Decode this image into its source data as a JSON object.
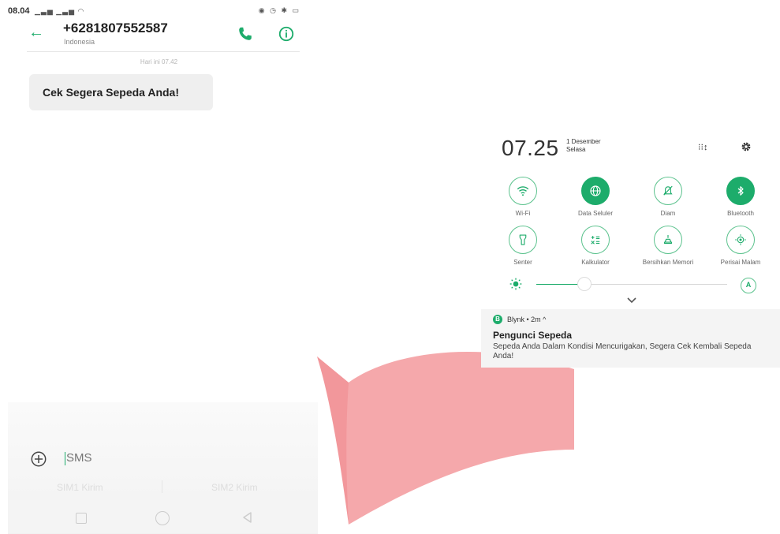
{
  "sms_screen": {
    "status_time": "08.04",
    "contact_number": "+6281807552587",
    "contact_country": "Indonesia",
    "message_date": "Hari ini 07.42",
    "message_text": "Cek Segera Sepeda Anda!",
    "compose_placeholder": "SMS",
    "sim1_label": "SIM1 Kirim",
    "sim2_label": "SIM2 Kirim"
  },
  "quick_settings": {
    "time": "07.25",
    "date_line1": "1 Desember",
    "date_line2": "Selasa",
    "tiles": [
      {
        "label": "Wi-Fi",
        "icon": "wifi-icon",
        "active": false
      },
      {
        "label": "Data Seluler",
        "icon": "globe-icon",
        "active": true
      },
      {
        "label": "Diam",
        "icon": "bell-off-icon",
        "active": false
      },
      {
        "label": "Bluetooth",
        "icon": "bluetooth-icon",
        "active": true
      },
      {
        "label": "Senter",
        "icon": "flashlight-icon",
        "active": false
      },
      {
        "label": "Kalkulator",
        "icon": "calculator-icon",
        "active": false
      },
      {
        "label": "Bersihkan Memori",
        "icon": "broom-icon",
        "active": false
      },
      {
        "label": "Perisai Malam",
        "icon": "eye-shield-icon",
        "active": false
      }
    ],
    "brightness_level": 0.25,
    "auto_brightness_label": "A"
  },
  "notification": {
    "app_initial": "B",
    "meta": "Blynk • 2m ^",
    "title": "Pengunci Sepeda",
    "body": "Sepeda Anda Dalam Kondisi Mencurigakan, Segera Cek Kembali Sepeda Anda!"
  },
  "colors": {
    "accent": "#1dac6b",
    "ribbon": "#f5a8ab"
  }
}
